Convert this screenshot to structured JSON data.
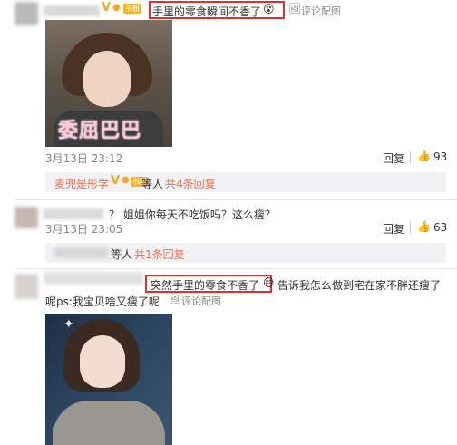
{
  "comment1": {
    "text": "手里的零食瞬间不香了",
    "pic_label": "评论配图",
    "image_caption": "委屈巴巴",
    "date": "3月13日 23:12",
    "reply_label": "回复",
    "likes": "93"
  },
  "reply_summary1": {
    "user": "麦兜是彤学",
    "middle": "等人",
    "count_link": "共4条回复"
  },
  "comment2": {
    "text": "？ 姐姐你每天不吃饭吗？这么瘦？",
    "date": "3月13日 23:05",
    "reply_label": "回复",
    "likes": "63"
  },
  "reply_summary2": {
    "middle": "等人",
    "count_link": "共1条回复"
  },
  "comment3": {
    "highlight": "突然手里的零食不香了",
    "text_after": "告诉我怎么做到宅在家不胖还瘦了",
    "line2": "呢ps:我宝贝啥又瘦了呢",
    "pic_label": "评论配图"
  },
  "colors": {
    "link": "#eb7350",
    "highlight_box": "#e0302a",
    "reply_bg": "#f2f2f5"
  },
  "icons": {
    "image": "image-icon",
    "like": "thumb-up-icon",
    "verified": "verified-v-icon"
  }
}
